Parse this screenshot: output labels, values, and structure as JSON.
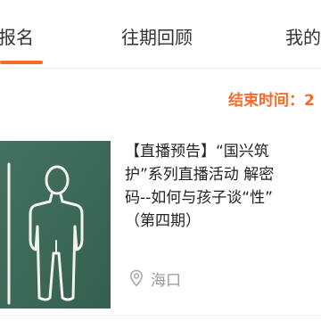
{
  "tabs": {
    "signup": "报名",
    "past": "往期回顾",
    "mine": "我的"
  },
  "colors": {
    "accent": "#f46b2a",
    "board": "#3d6a5a"
  },
  "event": {
    "end_time_label": "结束时间：2",
    "title_lines": [
      "【直播预告】“国兴筑",
      "护”系列直播活动 解密",
      "码--如何与孩子谈“性”",
      "（第四期）"
    ],
    "location_icon": "location-pin-icon",
    "location": "海口"
  }
}
